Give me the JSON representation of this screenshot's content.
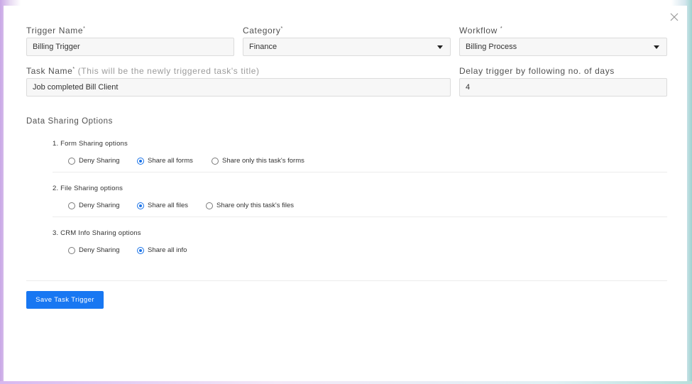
{
  "form": {
    "trigger_name": {
      "label": "Trigger Name",
      "required_mark": "*",
      "value": "Billing Trigger"
    },
    "category": {
      "label": "Category",
      "required_mark": "*",
      "value": "Finance"
    },
    "workflow": {
      "label": "Workflow ",
      "required_mark": "*",
      "value": "Billing Process"
    },
    "task_name": {
      "label": "Task Name",
      "required_mark": "*",
      "hint": " (This will be the newly triggered task's title)",
      "value": "Job completed Bill Client"
    },
    "delay": {
      "label": "Delay trigger by following no. of days",
      "value": "4"
    }
  },
  "sharing": {
    "title": "Data Sharing Options",
    "groups": [
      {
        "title": "1. Form Sharing options",
        "options": [
          "Deny Sharing",
          "Share all forms",
          "Share only this task's forms"
        ],
        "selected": 1
      },
      {
        "title": "2. File Sharing options",
        "options": [
          "Deny Sharing",
          "Share all files",
          "Share only this task's files"
        ],
        "selected": 1
      },
      {
        "title": "3. CRM Info Sharing options",
        "options": [
          "Deny Sharing",
          "Share all info"
        ],
        "selected": 1
      }
    ]
  },
  "actions": {
    "save_label": "Save Task Trigger"
  },
  "colors": {
    "primary": "#1877f2",
    "radio_selected": "#1a73e8"
  },
  "icons": {
    "close": "close-icon",
    "dropdown": "chevron-down-icon"
  }
}
